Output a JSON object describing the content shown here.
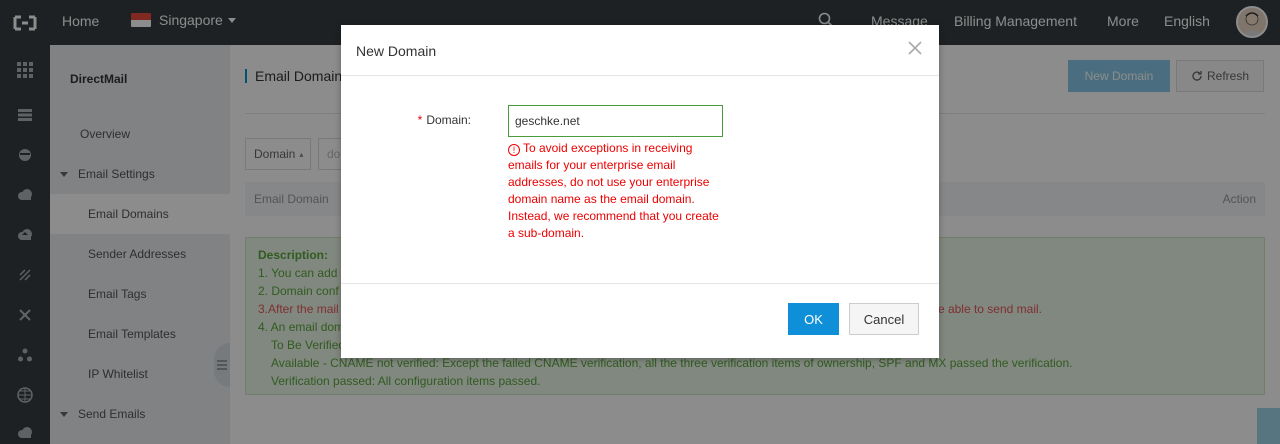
{
  "topbar": {
    "home": "Home",
    "region": "Singapore",
    "nav": [
      "Message",
      "Billing Management",
      "More",
      "English"
    ]
  },
  "rail_icons": [
    "grid-icon",
    "server-icon",
    "database-icon",
    "cloud-icon",
    "cloud-upload-icon",
    "network-icon",
    "cross-icon",
    "nodes-icon",
    "globe-icon",
    "cloud-sync-icon"
  ],
  "sidebar": {
    "title": "DirectMail",
    "items": [
      {
        "label": "Overview"
      },
      {
        "label": "Email Settings"
      },
      {
        "label": "Email Domains"
      },
      {
        "label": "Sender Addresses"
      },
      {
        "label": "Email Tags"
      },
      {
        "label": "Email Templates"
      },
      {
        "label": "IP Whitelist"
      },
      {
        "label": "Send Emails"
      }
    ]
  },
  "main": {
    "title": "Email Domains",
    "new_domain": "New Domain",
    "refresh": "Refresh",
    "filter_select": "Domain",
    "filter_placeholder": "do",
    "columns": [
      "Email Domain",
      "Action"
    ],
    "description": {
      "head": "Description:",
      "line1": "1. You can add",
      "line2": "2. Domain conf",
      "line3": "3.After the mail",
      "line3_tail": "e able to send mail.",
      "line4": "4. An email dom",
      "line5": "To Be Verified",
      "line6": "Available - CNAME not verified: Except the failed CNAME verification, all the three verification items of ownership, SPF and MX passed the verification.",
      "line7": "Verification passed: All configuration items passed."
    }
  },
  "dialog": {
    "title": "New Domain",
    "label": "Domain:",
    "value": "geschke.net",
    "error": "To avoid exceptions in receiving emails for your enterprise email addresses, do not use your enterprise domain name as the email domain. Instead, we recommend that you create a sub-domain.",
    "ok": "OK",
    "cancel": "Cancel"
  },
  "colors": {
    "topbar": "#373d41",
    "primary": "#0f8fd8",
    "error": "#e00000",
    "success_text": "#5aa63c"
  }
}
